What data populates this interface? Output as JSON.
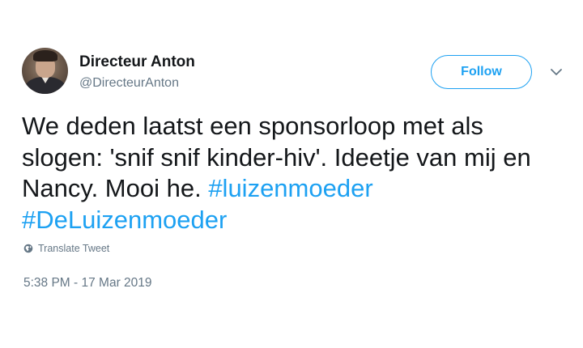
{
  "user": {
    "display_name": "Directeur Anton",
    "handle": "@DirecteurAnton"
  },
  "follow_button": {
    "label": "Follow"
  },
  "tweet": {
    "text_parts": [
      "We deden laatst een sponsorloop met als slogen: 'snif snif kinder-hiv'. Ideetje van mij en Nancy. Mooi he. ",
      "#luizenmoeder",
      " ",
      "#DeLuizenmoeder"
    ],
    "translate_label": "Translate Tweet",
    "timestamp": "5:38 PM - 17 Mar 2019"
  },
  "icons": {
    "caret": "chevron-down-icon",
    "translate": "globe-icon"
  },
  "colors": {
    "accent": "#1da1f2",
    "text": "#14171a",
    "muted": "#657786"
  }
}
